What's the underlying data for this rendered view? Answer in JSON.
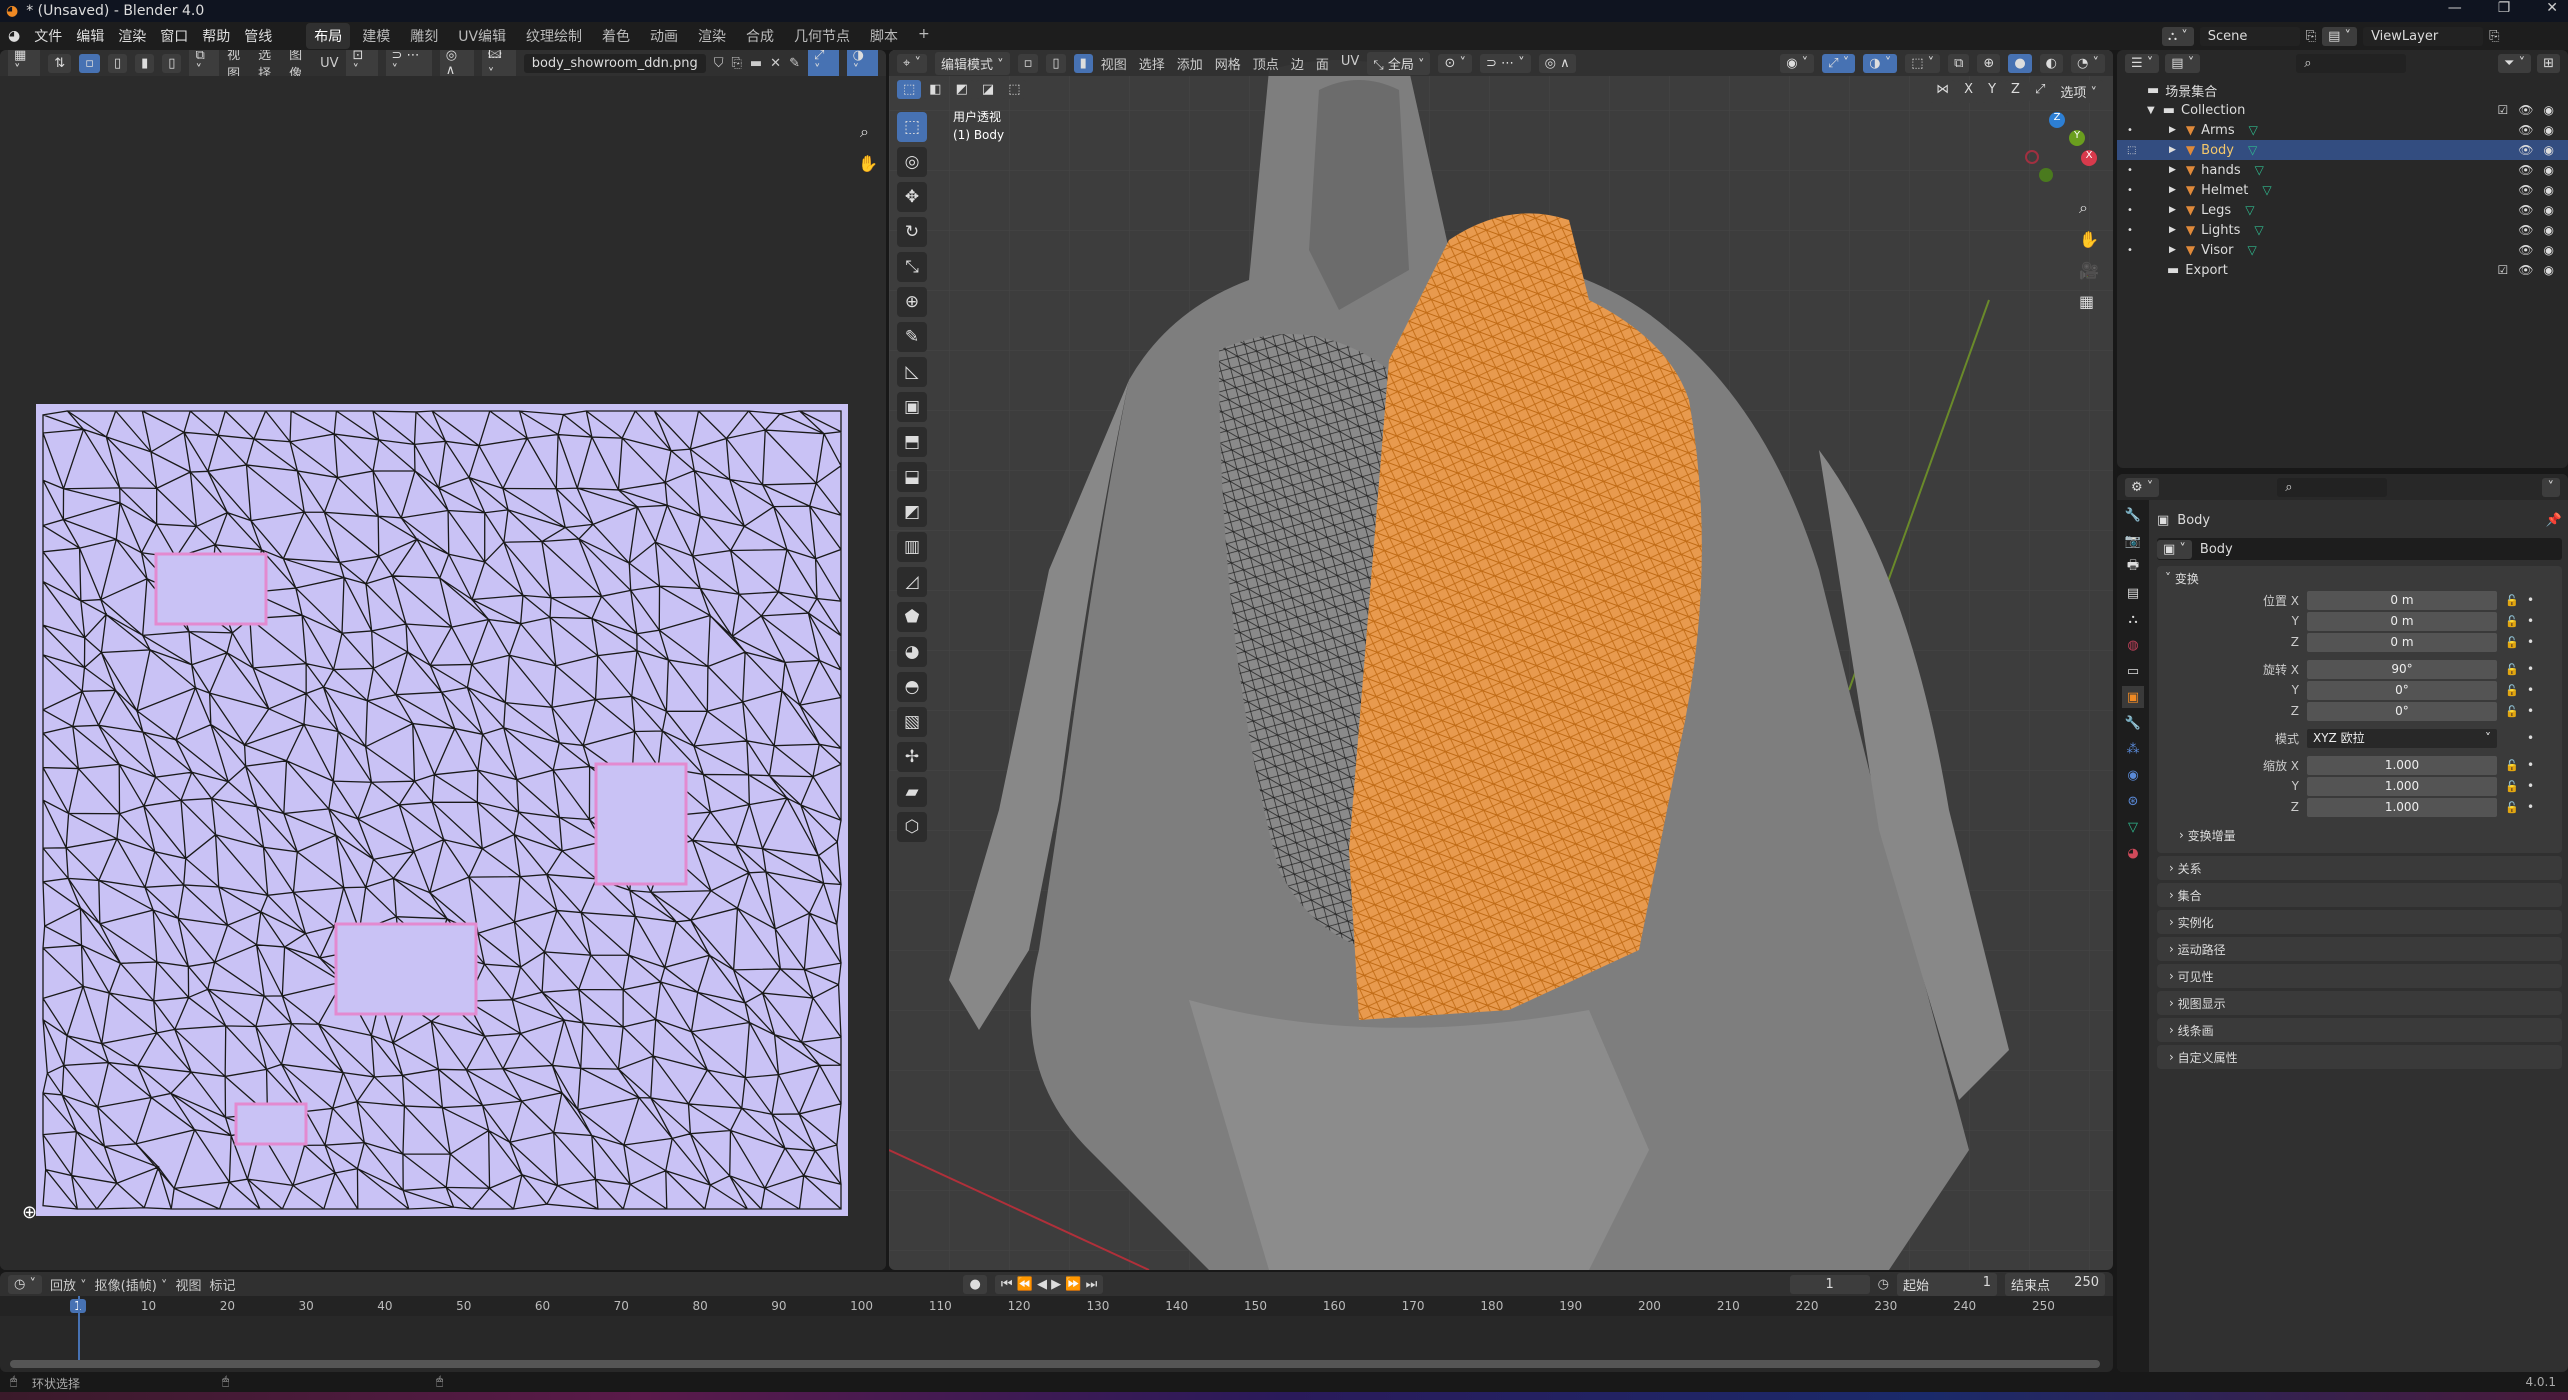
{
  "window": {
    "title": "* (Unsaved) - Blender 4.0",
    "controls": [
      "—",
      "❐",
      "✕"
    ]
  },
  "menu": {
    "items": [
      "文件",
      "编辑",
      "渲染",
      "窗口",
      "帮助",
      "管线"
    ],
    "workspaces": [
      "布局",
      "建模",
      "雕刻",
      "UV编辑",
      "纹理绘制",
      "着色",
      "动画",
      "渲染",
      "合成",
      "几何节点",
      "脚本",
      "+"
    ],
    "active_workspace": "布局"
  },
  "uv_editor": {
    "menus": [
      "视图",
      "选择",
      "图像",
      "UV"
    ],
    "image_name": "body_showroom_ddn.png",
    "bg_color": "#c9c2f5"
  },
  "viewport": {
    "mode": "编辑模式",
    "menus": [
      "视图",
      "选择",
      "添加",
      "网格",
      "顶点",
      "边",
      "面",
      "UV"
    ],
    "transform_orientation": "全局",
    "overlay_title": "用户透视",
    "overlay_object": "(1) Body",
    "axis_labels": [
      "X",
      "Y",
      "Z"
    ],
    "options_label": "选项",
    "gizmo": {
      "x": "X",
      "y": "Y",
      "z": "Z"
    },
    "selection_color": "#e8872a"
  },
  "outliner": {
    "scene_label": "Scene",
    "viewlayer_label": "ViewLayer",
    "root": "场景集合",
    "collection": "Collection",
    "objects": [
      {
        "name": "Arms",
        "selected": false
      },
      {
        "name": "Body",
        "selected": true
      },
      {
        "name": "hands",
        "selected": false
      },
      {
        "name": "Helmet",
        "selected": false
      },
      {
        "name": "Legs",
        "selected": false
      },
      {
        "name": "Lights",
        "selected": false
      },
      {
        "name": "Visor",
        "selected": false
      }
    ],
    "export_collection": "Export"
  },
  "properties": {
    "object_name": "Body",
    "data_name": "Body",
    "transform_label": "变换",
    "location": {
      "label": "位置 X",
      "x": "0 m",
      "y": "0 m",
      "z": "0 m"
    },
    "rotation": {
      "label": "旋转 X",
      "x": "90°",
      "y": "0°",
      "z": "0°"
    },
    "mode": {
      "label": "模式",
      "value": "XYZ 欧拉"
    },
    "scale": {
      "label": "缩放 X",
      "x": "1.000",
      "y": "1.000",
      "z": "1.000"
    },
    "axis_y": "Y",
    "axis_z": "Z",
    "delta_label": "变换增量",
    "sections": [
      "关系",
      "集合",
      "实例化",
      "运动路径",
      "可见性",
      "视图显示",
      "线条画",
      "自定义属性"
    ]
  },
  "timeline": {
    "menus": [
      "回放",
      "抠像(插帧)",
      "视图",
      "标记"
    ],
    "current_frame": "1",
    "start_label": "起始",
    "start": "1",
    "end_label": "结束点",
    "end": "250",
    "ticks": [
      "1",
      "10",
      "20",
      "30",
      "40",
      "50",
      "60",
      "70",
      "80",
      "90",
      "100",
      "110",
      "120",
      "130",
      "140",
      "150",
      "160",
      "170",
      "180",
      "190",
      "200",
      "210",
      "220",
      "230",
      "240",
      "250"
    ]
  },
  "status": {
    "hint": "环状选择",
    "version": "4.0.1"
  }
}
